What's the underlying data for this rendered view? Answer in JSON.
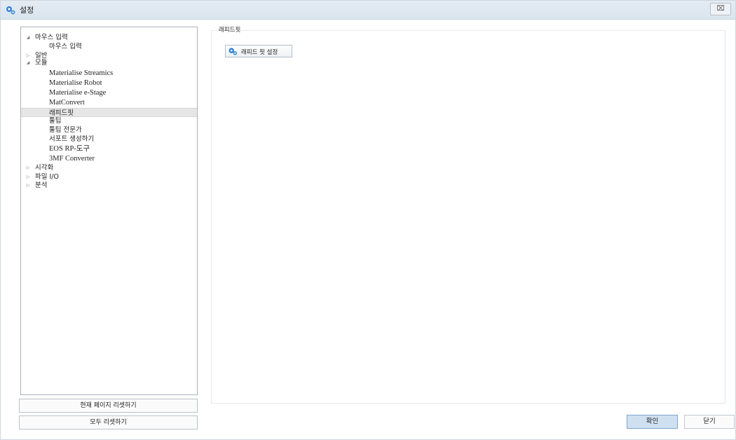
{
  "window": {
    "title": "설정",
    "close_label": "⌧"
  },
  "tree": {
    "items": [
      {
        "label": "마우스 입력",
        "expander": "◢"
      },
      {
        "label": "마우스 입력"
      },
      {
        "label": "일반",
        "expander": "▷"
      },
      {
        "label": "모듈",
        "expander": "◢"
      },
      {
        "label": "Materialise Streamics"
      },
      {
        "label": "Materialise Robot"
      },
      {
        "label": "Materialise e-Stage"
      },
      {
        "label": "MatConvert"
      },
      {
        "label": "래피드핏",
        "selected": true
      },
      {
        "label": "툴팁"
      },
      {
        "label": "툴팁 전문가"
      },
      {
        "label": "서포트 생성하기"
      },
      {
        "label": "EOS RP-도구"
      },
      {
        "label": "3MF Converter"
      },
      {
        "label": "시각화",
        "expander": "▷"
      },
      {
        "label": "파일 I/O",
        "expander": "▷"
      },
      {
        "label": "분석",
        "expander": "▷"
      }
    ]
  },
  "buttons": {
    "reset_page": "현재 페이지 리셋하기",
    "reset_all": "모두 리셋하기",
    "ok": "확인",
    "close": "닫기"
  },
  "content": {
    "section_header": "래피드핏",
    "quick_setup_button": "래피드 핏 설정"
  },
  "colors": {
    "ok_bg": "#cfe0f1",
    "icon_blue": "#2f7fd0",
    "selection": "#e6e6e6"
  }
}
